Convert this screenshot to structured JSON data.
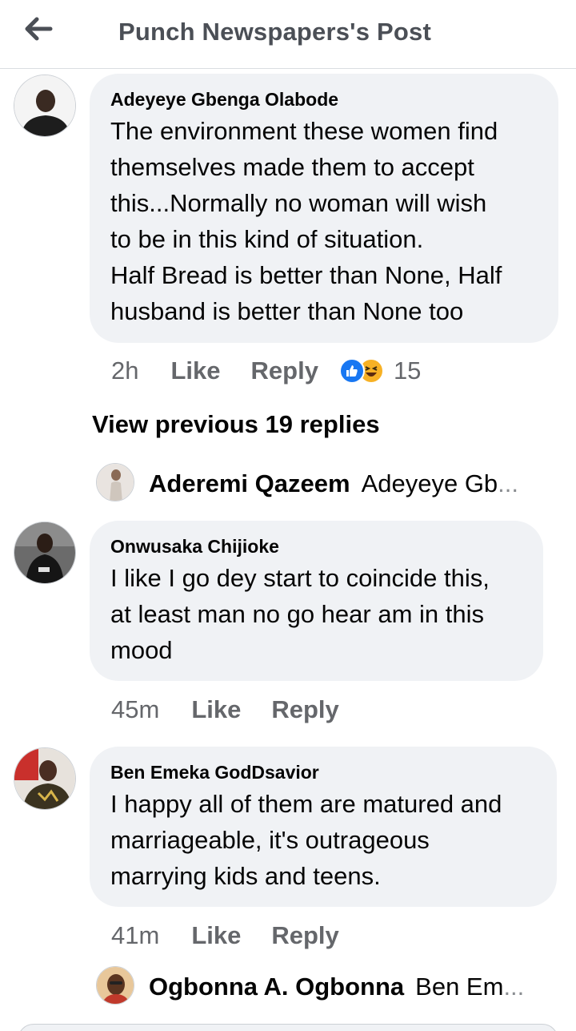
{
  "header": {
    "title": "Punch Newspapers's Post"
  },
  "comments": [
    {
      "author": "Adeyeye Gbenga Olabode",
      "text": "The environment these women find\nthemselves made them to accept\nthis...Normally no woman will wish\nto be in this kind of situation.\nHalf Bread is better than None, Half\nhusband is better than None too",
      "time": "2h",
      "like_label": "Like",
      "reply_label": "Reply",
      "reaction_count": "15",
      "reactions": [
        "like-icon",
        "haha-icon"
      ]
    },
    {
      "author": "Onwusaka Chijioke",
      "text": "I like I go dey start to coincide this,\nat least man no go hear am in this\nmood",
      "time": "45m",
      "like_label": "Like",
      "reply_label": "Reply"
    },
    {
      "author": "Ben Emeka GodDsavior",
      "text": "I happy all of them are matured and\nmarriageable, it's outrageous\nmarrying kids and teens.",
      "time": "41m",
      "like_label": "Like",
      "reply_label": "Reply"
    }
  ],
  "view_previous": "View previous 19 replies",
  "reply_previews": [
    {
      "name": "Aderemi Qazeem",
      "snippet": "Adeyeye Gb",
      "ellipsis": "..."
    },
    {
      "name": "Ogbonna A. Ogbonna",
      "snippet": "Ben Em",
      "ellipsis": "..."
    }
  ],
  "colors": {
    "bubble": "#f0f2f5",
    "meta": "#65676b",
    "like": "#1877f2",
    "haha": "#f7b125"
  }
}
